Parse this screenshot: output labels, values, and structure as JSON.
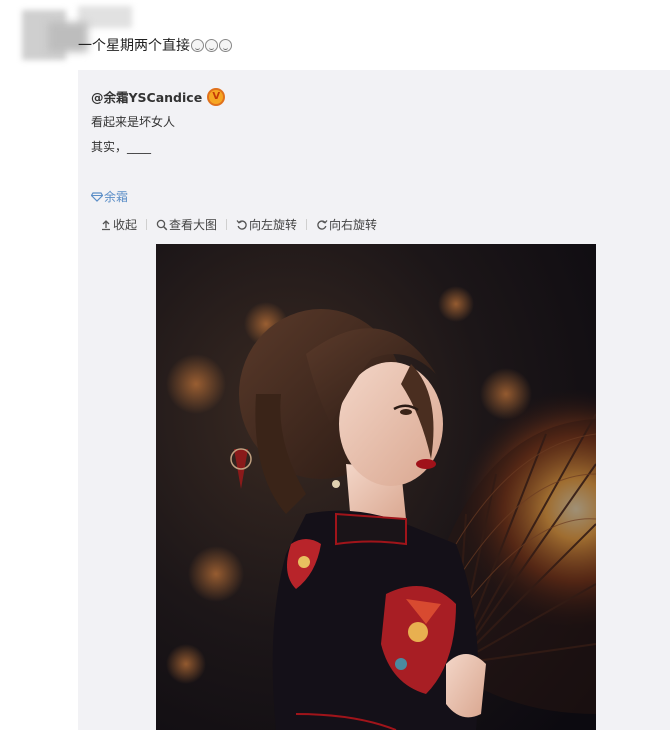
{
  "post": {
    "text": "一个星期两个直接",
    "emoji_count": 3,
    "emoji_name": "smile-emoji"
  },
  "repost": {
    "author": "@余霜YSCandice",
    "verified_badge": "V",
    "line1": "看起来是坏女人",
    "line2": "其实，____",
    "topic": "余霜"
  },
  "toolbar": {
    "collapse": "收起",
    "view_large": "查看大图",
    "rotate_left": "向左旋转",
    "rotate_right": "向右旋转"
  },
  "colors": {
    "link": "#5b8ec7",
    "repost_bg": "#f2f2f5",
    "badge": "#f6a623"
  },
  "image": {
    "name": "photo-woman-with-lace-fan"
  }
}
